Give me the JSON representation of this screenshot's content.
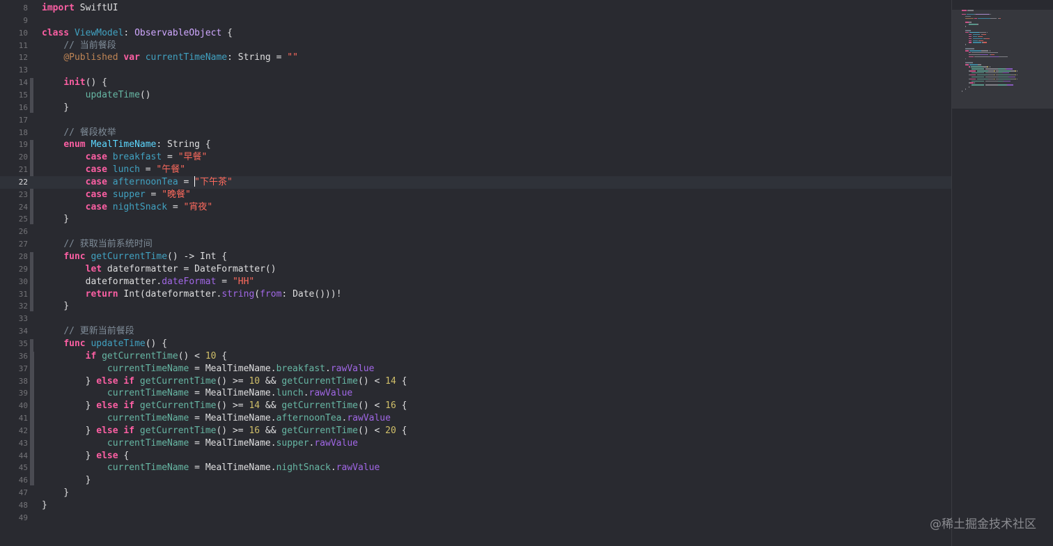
{
  "editor": {
    "language": "Swift",
    "current_line": 22,
    "lines": [
      {
        "n": "8",
        "tokens": [
          [
            "kw",
            "import"
          ],
          [
            "plain",
            " SwiftUI"
          ]
        ]
      },
      {
        "n": "9",
        "tokens": []
      },
      {
        "n": "10",
        "tokens": [
          [
            "kw",
            "class"
          ],
          [
            "plain",
            " "
          ],
          [
            "decl",
            "ViewModel"
          ],
          [
            "plain",
            ": "
          ],
          [
            "tname",
            "ObservableObject"
          ],
          [
            "plain",
            " {"
          ]
        ]
      },
      {
        "n": "11",
        "tokens": [
          [
            "plain",
            "    "
          ],
          [
            "cmt",
            "// 当前餐段"
          ]
        ]
      },
      {
        "n": "12",
        "tokens": [
          [
            "plain",
            "    "
          ],
          [
            "attr",
            "@Published"
          ],
          [
            "plain",
            " "
          ],
          [
            "kw",
            "var"
          ],
          [
            "plain",
            " "
          ],
          [
            "decl",
            "currentTimeName"
          ],
          [
            "plain",
            ": "
          ],
          [
            "plain",
            "String"
          ],
          [
            "plain",
            " = "
          ],
          [
            "str",
            "\"\""
          ]
        ]
      },
      {
        "n": "13",
        "tokens": []
      },
      {
        "n": "14",
        "tokens": [
          [
            "plain",
            "    "
          ],
          [
            "kw",
            "init"
          ],
          [
            "plain",
            "() {"
          ]
        ]
      },
      {
        "n": "15",
        "tokens": [
          [
            "plain",
            "        "
          ],
          [
            "fn",
            "updateTime"
          ],
          [
            "plain",
            "()"
          ]
        ]
      },
      {
        "n": "16",
        "tokens": [
          [
            "plain",
            "    }"
          ]
        ]
      },
      {
        "n": "17",
        "tokens": []
      },
      {
        "n": "18",
        "tokens": [
          [
            "plain",
            "    "
          ],
          [
            "cmt",
            "// 餐段枚举"
          ]
        ]
      },
      {
        "n": "19",
        "tokens": [
          [
            "plain",
            "    "
          ],
          [
            "kw",
            "enum"
          ],
          [
            "plain",
            " "
          ],
          [
            "typ",
            "MealTimeName"
          ],
          [
            "plain",
            ": "
          ],
          [
            "plain",
            "String"
          ],
          [
            "plain",
            " {"
          ]
        ]
      },
      {
        "n": "20",
        "tokens": [
          [
            "plain",
            "        "
          ],
          [
            "kw",
            "case"
          ],
          [
            "plain",
            " "
          ],
          [
            "decl",
            "breakfast"
          ],
          [
            "plain",
            " = "
          ],
          [
            "str",
            "\"早餐\""
          ]
        ]
      },
      {
        "n": "21",
        "tokens": [
          [
            "plain",
            "        "
          ],
          [
            "kw",
            "case"
          ],
          [
            "plain",
            " "
          ],
          [
            "decl",
            "lunch"
          ],
          [
            "plain",
            " = "
          ],
          [
            "str",
            "\"午餐\""
          ]
        ]
      },
      {
        "n": "22",
        "tokens": [
          [
            "plain",
            "        "
          ],
          [
            "kw",
            "case"
          ],
          [
            "plain",
            " "
          ],
          [
            "decl",
            "afternoonTea"
          ],
          [
            "plain",
            " = "
          ],
          [
            "caret",
            ""
          ],
          [
            "str",
            "\"下午茶\""
          ]
        ]
      },
      {
        "n": "23",
        "tokens": [
          [
            "plain",
            "        "
          ],
          [
            "kw",
            "case"
          ],
          [
            "plain",
            " "
          ],
          [
            "decl",
            "supper"
          ],
          [
            "plain",
            " = "
          ],
          [
            "str",
            "\"晚餐\""
          ]
        ]
      },
      {
        "n": "24",
        "tokens": [
          [
            "plain",
            "        "
          ],
          [
            "kw",
            "case"
          ],
          [
            "plain",
            " "
          ],
          [
            "decl",
            "nightSnack"
          ],
          [
            "plain",
            " = "
          ],
          [
            "str",
            "\"宵夜\""
          ]
        ]
      },
      {
        "n": "25",
        "tokens": [
          [
            "plain",
            "    }"
          ]
        ]
      },
      {
        "n": "26",
        "tokens": []
      },
      {
        "n": "27",
        "tokens": [
          [
            "plain",
            "    "
          ],
          [
            "cmt",
            "// 获取当前系统时间"
          ]
        ]
      },
      {
        "n": "28",
        "tokens": [
          [
            "plain",
            "    "
          ],
          [
            "kw",
            "func"
          ],
          [
            "plain",
            " "
          ],
          [
            "decl",
            "getCurrentTime"
          ],
          [
            "plain",
            "() -> "
          ],
          [
            "plain",
            "Int"
          ],
          [
            "plain",
            " {"
          ]
        ]
      },
      {
        "n": "29",
        "tokens": [
          [
            "plain",
            "        "
          ],
          [
            "kw",
            "let"
          ],
          [
            "plain",
            " dateformatter = "
          ],
          [
            "plain",
            "DateFormatter"
          ],
          [
            "plain",
            "()"
          ]
        ]
      },
      {
        "n": "30",
        "tokens": [
          [
            "plain",
            "        dateformatter."
          ],
          [
            "prop",
            "dateFormat"
          ],
          [
            "plain",
            " = "
          ],
          [
            "str",
            "\"HH\""
          ]
        ]
      },
      {
        "n": "31",
        "tokens": [
          [
            "plain",
            "        "
          ],
          [
            "kw",
            "return"
          ],
          [
            "plain",
            " Int(dateformatter."
          ],
          [
            "prop",
            "string"
          ],
          [
            "plain",
            "("
          ],
          [
            "prop",
            "from"
          ],
          [
            "plain",
            ": Date()))!"
          ]
        ]
      },
      {
        "n": "32",
        "tokens": [
          [
            "plain",
            "    }"
          ]
        ]
      },
      {
        "n": "33",
        "tokens": []
      },
      {
        "n": "34",
        "tokens": [
          [
            "plain",
            "    "
          ],
          [
            "cmt",
            "// 更新当前餐段"
          ]
        ]
      },
      {
        "n": "35",
        "tokens": [
          [
            "plain",
            "    "
          ],
          [
            "kw",
            "func"
          ],
          [
            "plain",
            " "
          ],
          [
            "decl",
            "updateTime"
          ],
          [
            "plain",
            "() {"
          ]
        ]
      },
      {
        "n": "36",
        "tokens": [
          [
            "plain",
            "        "
          ],
          [
            "kw",
            "if"
          ],
          [
            "plain",
            " "
          ],
          [
            "fn",
            "getCurrentTime"
          ],
          [
            "plain",
            "() < "
          ],
          [
            "num",
            "10"
          ],
          [
            "plain",
            " {"
          ]
        ]
      },
      {
        "n": "37",
        "tokens": [
          [
            "plain",
            "            "
          ],
          [
            "fn",
            "currentTimeName"
          ],
          [
            "plain",
            " = "
          ],
          [
            "plain",
            "MealTimeName"
          ],
          [
            "plain",
            "."
          ],
          [
            "fn",
            "breakfast"
          ],
          [
            "plain",
            "."
          ],
          [
            "prop",
            "rawValue"
          ]
        ]
      },
      {
        "n": "38",
        "tokens": [
          [
            "plain",
            "        } "
          ],
          [
            "kw",
            "else if"
          ],
          [
            "plain",
            " "
          ],
          [
            "fn",
            "getCurrentTime"
          ],
          [
            "plain",
            "() >= "
          ],
          [
            "num",
            "10"
          ],
          [
            "plain",
            " && "
          ],
          [
            "fn",
            "getCurrentTime"
          ],
          [
            "plain",
            "() < "
          ],
          [
            "num",
            "14"
          ],
          [
            "plain",
            " {"
          ]
        ]
      },
      {
        "n": "39",
        "tokens": [
          [
            "plain",
            "            "
          ],
          [
            "fn",
            "currentTimeName"
          ],
          [
            "plain",
            " = "
          ],
          [
            "plain",
            "MealTimeName"
          ],
          [
            "plain",
            "."
          ],
          [
            "fn",
            "lunch"
          ],
          [
            "plain",
            "."
          ],
          [
            "prop",
            "rawValue"
          ]
        ]
      },
      {
        "n": "40",
        "tokens": [
          [
            "plain",
            "        } "
          ],
          [
            "kw",
            "else if"
          ],
          [
            "plain",
            " "
          ],
          [
            "fn",
            "getCurrentTime"
          ],
          [
            "plain",
            "() >= "
          ],
          [
            "num",
            "14"
          ],
          [
            "plain",
            " && "
          ],
          [
            "fn",
            "getCurrentTime"
          ],
          [
            "plain",
            "() < "
          ],
          [
            "num",
            "16"
          ],
          [
            "plain",
            " {"
          ]
        ]
      },
      {
        "n": "41",
        "tokens": [
          [
            "plain",
            "            "
          ],
          [
            "fn",
            "currentTimeName"
          ],
          [
            "plain",
            " = "
          ],
          [
            "plain",
            "MealTimeName"
          ],
          [
            "plain",
            "."
          ],
          [
            "fn",
            "afternoonTea"
          ],
          [
            "plain",
            "."
          ],
          [
            "prop",
            "rawValue"
          ]
        ]
      },
      {
        "n": "42",
        "tokens": [
          [
            "plain",
            "        } "
          ],
          [
            "kw",
            "else if"
          ],
          [
            "plain",
            " "
          ],
          [
            "fn",
            "getCurrentTime"
          ],
          [
            "plain",
            "() >= "
          ],
          [
            "num",
            "16"
          ],
          [
            "plain",
            " && "
          ],
          [
            "fn",
            "getCurrentTime"
          ],
          [
            "plain",
            "() < "
          ],
          [
            "num",
            "20"
          ],
          [
            "plain",
            " {"
          ]
        ]
      },
      {
        "n": "43",
        "tokens": [
          [
            "plain",
            "            "
          ],
          [
            "fn",
            "currentTimeName"
          ],
          [
            "plain",
            " = "
          ],
          [
            "plain",
            "MealTimeName"
          ],
          [
            "plain",
            "."
          ],
          [
            "fn",
            "supper"
          ],
          [
            "plain",
            "."
          ],
          [
            "prop",
            "rawValue"
          ]
        ]
      },
      {
        "n": "44",
        "tokens": [
          [
            "plain",
            "        } "
          ],
          [
            "kw",
            "else"
          ],
          [
            "plain",
            " {"
          ]
        ]
      },
      {
        "n": "45",
        "tokens": [
          [
            "plain",
            "            "
          ],
          [
            "fn",
            "currentTimeName"
          ],
          [
            "plain",
            " = "
          ],
          [
            "plain",
            "MealTimeName"
          ],
          [
            "plain",
            "."
          ],
          [
            "fn",
            "nightSnack"
          ],
          [
            "plain",
            "."
          ],
          [
            "prop",
            "rawValue"
          ]
        ]
      },
      {
        "n": "46",
        "tokens": [
          [
            "plain",
            "        }"
          ]
        ]
      },
      {
        "n": "47",
        "tokens": [
          [
            "plain",
            "    }"
          ]
        ]
      },
      {
        "n": "48",
        "tokens": [
          [
            "plain",
            "}"
          ]
        ]
      },
      {
        "n": "49",
        "tokens": []
      }
    ]
  },
  "watermark": "@稀土掘金技术社区",
  "colors": {
    "background": "#292a30",
    "keyword": "#fc5fa3",
    "string": "#fc6a5d",
    "number": "#d0bf69",
    "comment": "#7f8c98",
    "declaration": "#41a1c0",
    "type": "#5dd8ff",
    "function": "#67b7a4",
    "property": "#a167e6"
  }
}
